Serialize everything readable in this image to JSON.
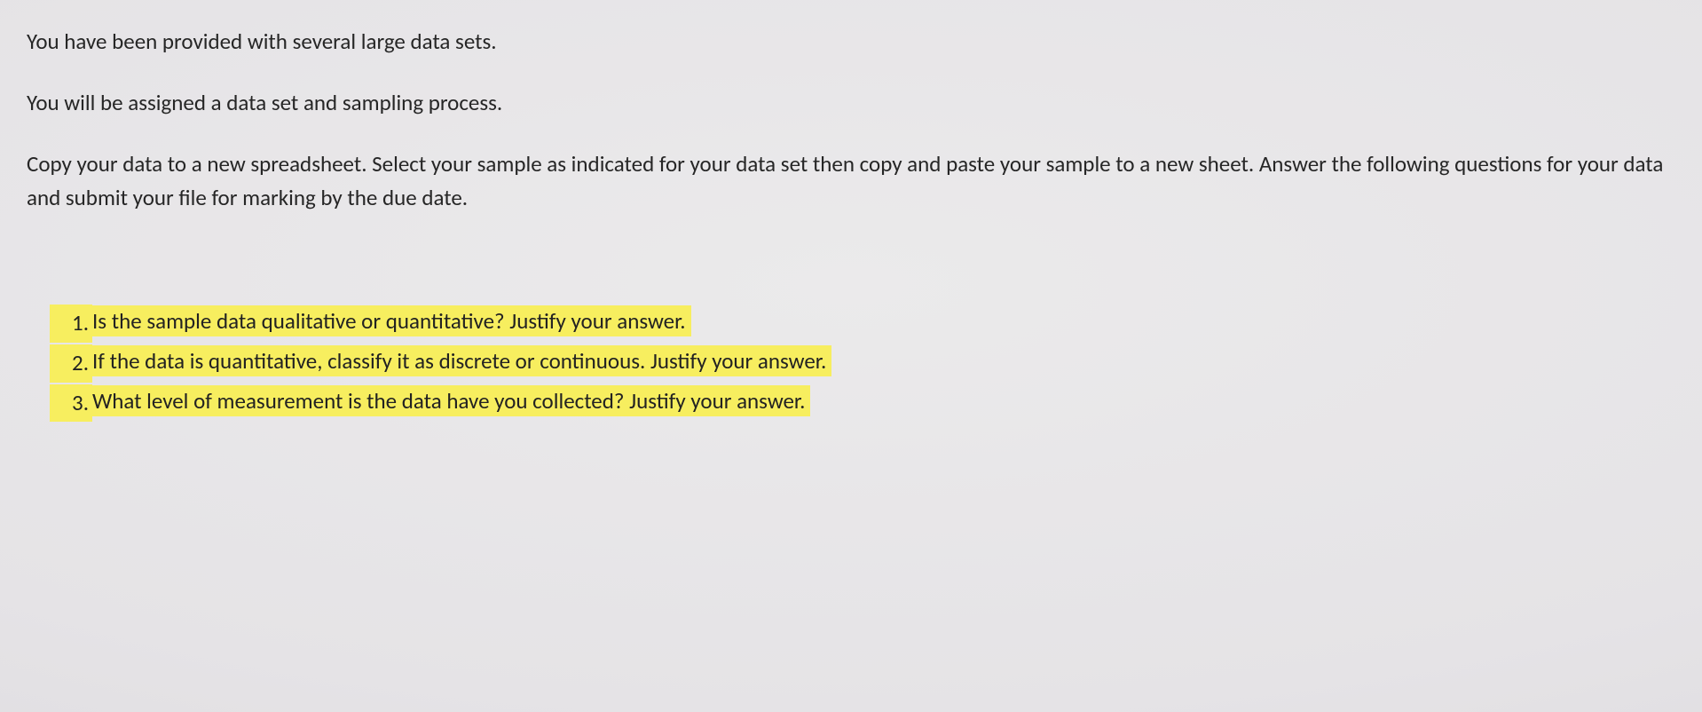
{
  "intro": {
    "p1": "You have been provided with several large data sets.",
    "p2": "You will be assigned a data set and sampling process.",
    "p3": "Copy your data to a new spreadsheet. Select your sample as indicated for your data set then copy and paste your sample to a new sheet.  Answer the following questions for your data and submit your file for marking by the due date."
  },
  "questions": {
    "q1": "Is the sample data qualitative or quantitative? Justify your answer.",
    "q2": "If the data is quantitative, classify it as discrete or continuous.  Justify your answer.",
    "q3": "What level of measurement is the data have you collected?  Justify your answer."
  }
}
